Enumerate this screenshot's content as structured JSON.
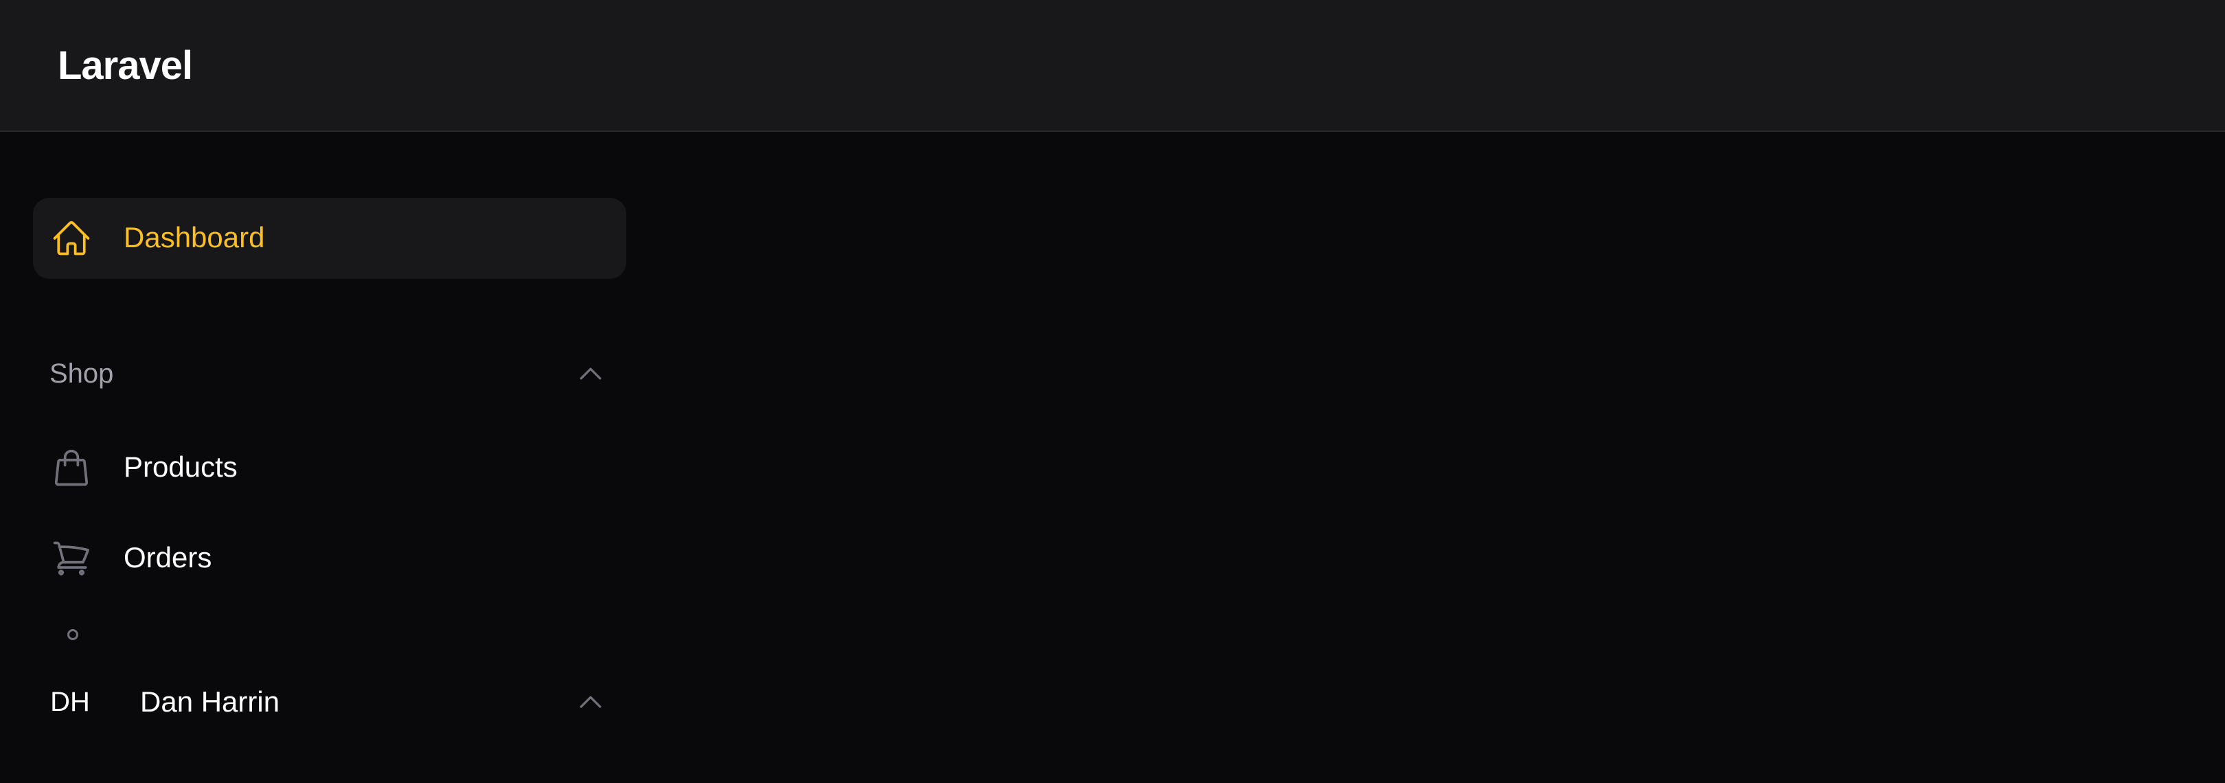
{
  "brand": {
    "name": "Laravel"
  },
  "sidebar": {
    "items": [
      {
        "label": "Dashboard",
        "icon": "home-icon",
        "active": true
      }
    ],
    "groups": [
      {
        "label": "Shop",
        "expanded": true,
        "collapse_icon": "chevron-up-icon",
        "items": [
          {
            "label": "Products",
            "icon": "shopping-bag-icon"
          },
          {
            "label": "Orders",
            "icon": "shopping-cart-icon"
          }
        ]
      }
    ]
  },
  "user": {
    "initials": "DH",
    "name": "Dan Harrin",
    "menu_icon": "chevron-up-icon"
  },
  "colors": {
    "accent": "#fbbf24",
    "background": "#09090b",
    "topbar": "#18181b",
    "active_item_bg": "#18181b",
    "icon_muted": "#71717a",
    "group_label": "#a1a1aa"
  }
}
